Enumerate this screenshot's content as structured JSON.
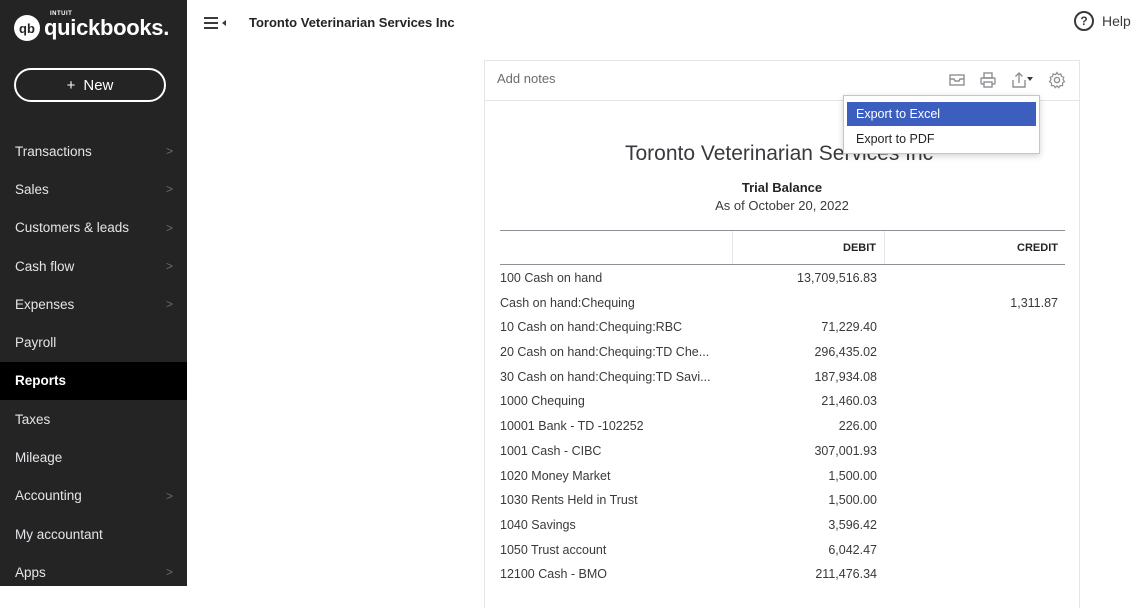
{
  "app": {
    "logo_intuit": "INTUIT",
    "logo_text": "quickbooks.",
    "logo_mark": "qb"
  },
  "sidebar": {
    "new_button": "New",
    "items": [
      {
        "label": "Transactions",
        "chevron": true,
        "active": false
      },
      {
        "label": "Sales",
        "chevron": true,
        "active": false
      },
      {
        "label": "Customers & leads",
        "chevron": true,
        "active": false
      },
      {
        "label": "Cash flow",
        "chevron": true,
        "active": false
      },
      {
        "label": "Expenses",
        "chevron": true,
        "active": false
      },
      {
        "label": "Payroll",
        "chevron": false,
        "active": false
      },
      {
        "label": "Reports",
        "chevron": false,
        "active": true
      },
      {
        "label": "Taxes",
        "chevron": false,
        "active": false
      },
      {
        "label": "Mileage",
        "chevron": false,
        "active": false
      },
      {
        "label": "Accounting",
        "chevron": true,
        "active": false
      },
      {
        "label": "My accountant",
        "chevron": false,
        "active": false
      },
      {
        "label": "Apps",
        "chevron": true,
        "active": false
      }
    ]
  },
  "header": {
    "company": "Toronto Veterinarian Services Inc",
    "help": "Help",
    "help_symbol": "?"
  },
  "report": {
    "add_notes": "Add notes",
    "company": "Toronto Veterinarian Services Inc",
    "title": "Trial Balance",
    "date": "As of October 20, 2022",
    "columns": {
      "debit": "DEBIT",
      "credit": "CREDIT"
    },
    "rows": [
      {
        "account": "100 Cash on hand",
        "debit": "13,709,516.83",
        "credit": ""
      },
      {
        "account": "Cash on hand:Chequing",
        "debit": "",
        "credit": "1,311.87"
      },
      {
        "account": "10 Cash on hand:Chequing:RBC",
        "debit": "71,229.40",
        "credit": ""
      },
      {
        "account": "20 Cash on hand:Chequing:TD Che...",
        "debit": "296,435.02",
        "credit": ""
      },
      {
        "account": "30 Cash on hand:Chequing:TD Savi...",
        "debit": "187,934.08",
        "credit": ""
      },
      {
        "account": "1000 Chequing",
        "debit": "21,460.03",
        "credit": ""
      },
      {
        "account": "10001 Bank - TD -102252",
        "debit": "226.00",
        "credit": ""
      },
      {
        "account": "1001 Cash - CIBC",
        "debit": "307,001.93",
        "credit": ""
      },
      {
        "account": "1020 Money Market",
        "debit": "1,500.00",
        "credit": ""
      },
      {
        "account": "1030 Rents Held in Trust",
        "debit": "1,500.00",
        "credit": ""
      },
      {
        "account": "1040 Savings",
        "debit": "3,596.42",
        "credit": ""
      },
      {
        "account": "1050 Trust account",
        "debit": "6,042.47",
        "credit": ""
      },
      {
        "account": "12100 Cash - BMO",
        "debit": "211,476.34",
        "credit": ""
      }
    ]
  },
  "export_menu": {
    "items": [
      "Export to Excel",
      "Export to PDF"
    ],
    "selected": "Export to Excel"
  },
  "colors": {
    "sidebar_bg": "#242424",
    "active_item_bg": "#000000",
    "menu_highlight": "#3c5fbf"
  }
}
